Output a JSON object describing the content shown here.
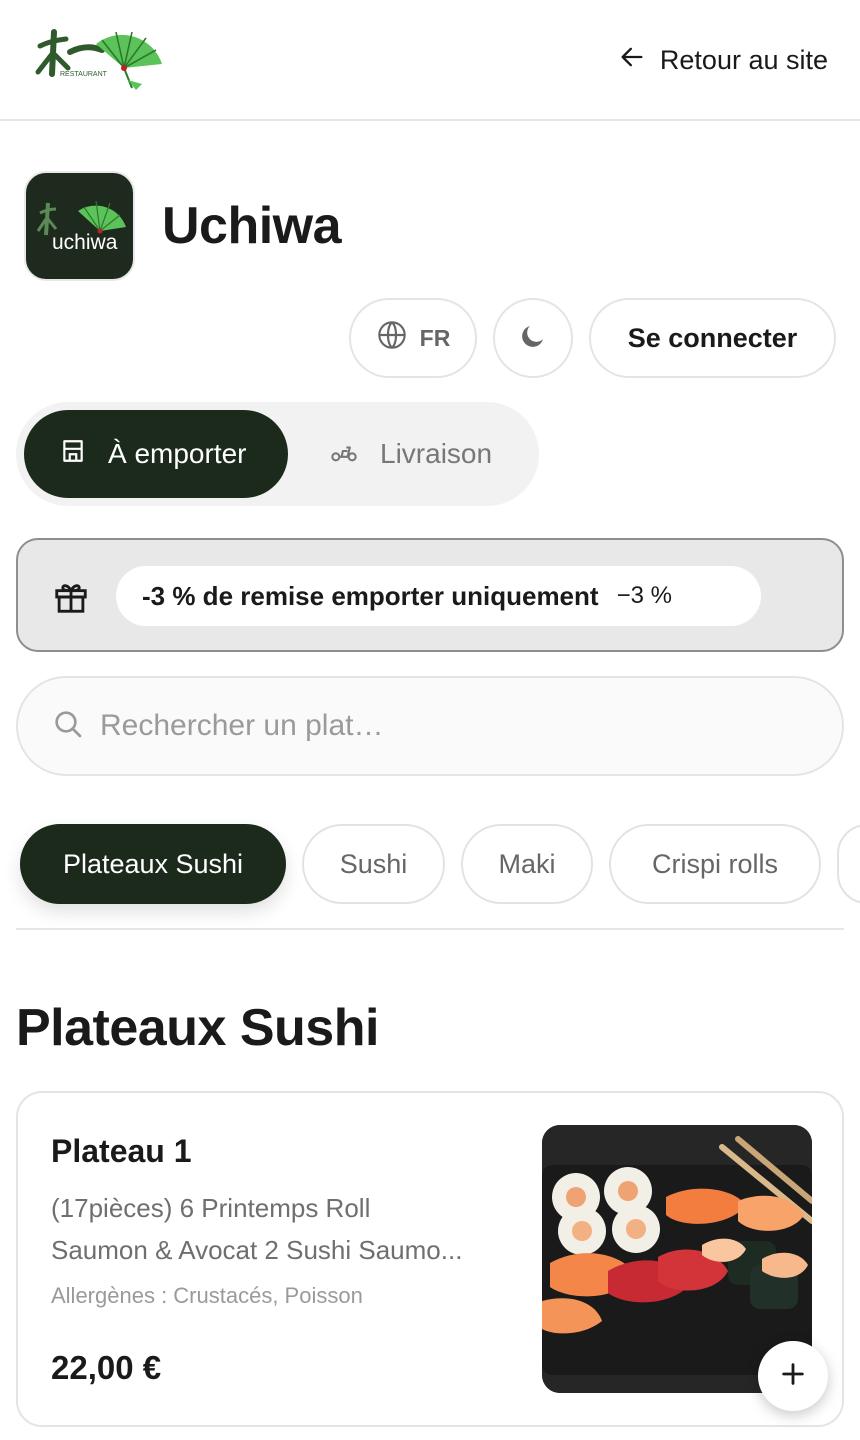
{
  "header": {
    "logo_text": "RESTAURANT",
    "back_label": "Retour au site"
  },
  "store": {
    "name": "Uchiwa",
    "logo_text": "uchiwa"
  },
  "controls": {
    "language": "FR",
    "theme_icon": "moon-icon",
    "login_label": "Se connecter"
  },
  "order_modes": [
    {
      "label": "À emporter",
      "icon": "store-icon",
      "selected": true
    },
    {
      "label": "Livraison",
      "icon": "scooter-icon",
      "selected": false
    }
  ],
  "promo": {
    "icon": "gift-icon",
    "text": "-3 % de remise emporter uniquement",
    "badge": "−3 %"
  },
  "search": {
    "placeholder": "Rechercher un plat…",
    "value": ""
  },
  "categories": [
    {
      "label": "Plateaux Sushi",
      "active": true
    },
    {
      "label": "Sushi",
      "active": false
    },
    {
      "label": "Maki",
      "active": false
    },
    {
      "label": "Crispi rolls",
      "active": false
    }
  ],
  "section": {
    "title": "Plateaux Sushi"
  },
  "products": [
    {
      "name": "Plateau 1",
      "description_line1": "(17pièces) 6 Printemps Roll",
      "description_line2": "Saumon & Avocat 2 Sushi Saumo...",
      "allergens": "Allergènes : Crustacés, Poisson",
      "price": "22,00 €",
      "add_icon": "plus-icon"
    }
  ],
  "colors": {
    "brand_dark": "#1c2a1c",
    "logo_green": "#3f9a3a",
    "promo_bg": "#e8e8e8",
    "text_muted": "#6f6f6f"
  }
}
